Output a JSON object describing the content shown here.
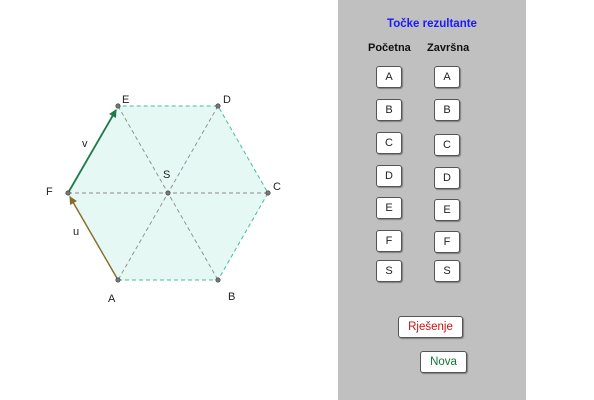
{
  "figure": {
    "points": [
      "A",
      "B",
      "C",
      "D",
      "E",
      "F",
      "S"
    ],
    "vector_v_label": "v",
    "vector_u_label": "u",
    "colors": {
      "hexagon_fill": "#e6f8f4",
      "hexagon_edge": "#3fbfa0",
      "vector_v": "#1e7a4a",
      "vector_u": "#8a6a2a",
      "inner_lines": "#888888"
    }
  },
  "panel": {
    "title": "Točke rezultante",
    "start_header": "Početna",
    "end_header": "Završna",
    "start_buttons": [
      "A",
      "B",
      "C",
      "D",
      "E",
      "F",
      "S"
    ],
    "end_buttons": [
      "A",
      "B",
      "C",
      "D",
      "E",
      "F",
      "S"
    ],
    "solution_label": "Rješenje",
    "new_label": "Nova",
    "colors": {
      "title": "#1a1aff",
      "solution": "#cc1111",
      "new": "#117733",
      "background": "#c0c0c0"
    }
  }
}
